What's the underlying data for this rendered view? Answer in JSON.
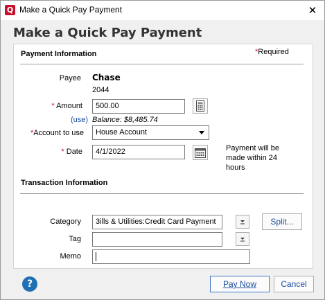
{
  "window": {
    "title": "Make a Quick Pay Payment",
    "close_glyph": "✕",
    "app_icon_letter": "Q"
  },
  "heading": "Make a Quick Pay Payment",
  "payment_info": {
    "section_title": "Payment Information",
    "required_note": "Required",
    "required_star": "*",
    "payee_label": "Payee",
    "payee_name": "Chase",
    "payee_account": "2044",
    "amount_label": "Amount",
    "amount_value": "500.00",
    "use_link": "(use)",
    "balance_text": "Balance: $8,485.74",
    "account_label": "Account to use",
    "account_value": "House Account",
    "date_label": "Date",
    "date_value": "4/1/2022",
    "date_note": "Payment will be made within 24 hours"
  },
  "transaction_info": {
    "section_title": "Transaction Information",
    "category_label": "Category",
    "category_value": "3ills & Utilities:Credit Card Payment",
    "split_label": "Split...",
    "tag_label": "Tag",
    "tag_value": "",
    "memo_label": "Memo",
    "memo_value": ""
  },
  "footer": {
    "help_glyph": "?",
    "pay_now_label": "Pay Now",
    "cancel_label": "Cancel"
  },
  "colors": {
    "required_star": "#c8102e",
    "link": "#1c4fa0",
    "help_icon": "#1f6fb5"
  },
  "icons": [
    "quicken-app-icon",
    "close-icon",
    "calculator-icon",
    "calendar-icon",
    "dropdown-arrow-icon",
    "help-icon"
  ]
}
